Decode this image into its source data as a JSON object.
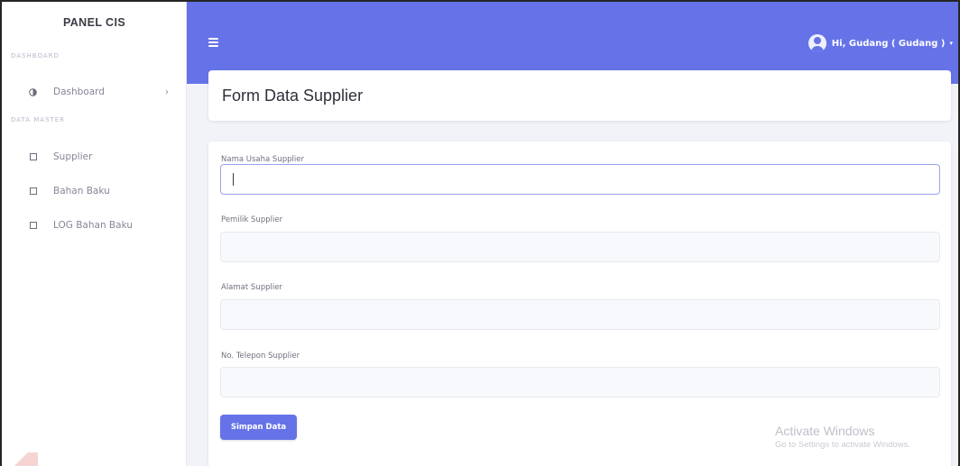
{
  "sidebar": {
    "brand": "PANEL CIS",
    "section_dashboard": "DASHBOARD",
    "section_master": "DATA MASTER",
    "items": [
      {
        "label": "Dashboard",
        "icon": "palette-icon",
        "has_chevron": true
      },
      {
        "label": "Supplier",
        "icon": "square-icon"
      },
      {
        "label": "Bahan Baku",
        "icon": "square-icon"
      },
      {
        "label": "LOG Bahan Baku",
        "icon": "square-icon"
      }
    ],
    "chevron": "›"
  },
  "topbar": {
    "user_label": "Hi, Gudang ( Gudang )",
    "caret": "▾",
    "bg_color": "#6673e8"
  },
  "page": {
    "title": "Form Data Supplier"
  },
  "form": {
    "fields": [
      {
        "label": "Nama Usaha Supplier",
        "value": "",
        "focused": true
      },
      {
        "label": "Pemilik Supplier",
        "value": ""
      },
      {
        "label": "Alamat Supplier",
        "value": ""
      },
      {
        "label": "No. Telepon Supplier",
        "value": ""
      }
    ],
    "submit_label": "Simpan Data"
  },
  "watermark": {
    "title": "Activate Windows",
    "subtitle": "Go to Settings to activate Windows."
  }
}
